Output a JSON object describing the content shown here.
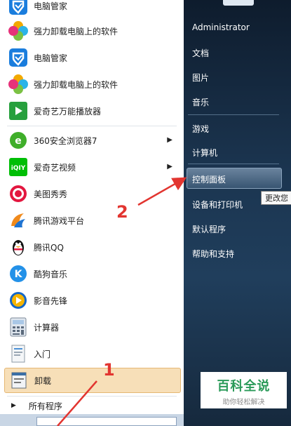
{
  "start_menu": {
    "programs": [
      {
        "label": "电脑管家",
        "icon": "tencent-pc-manager-icon"
      },
      {
        "label": "强力卸载电脑上的软件",
        "icon": "pinwheel-uninstall-icon"
      },
      {
        "label": "电脑管家",
        "icon": "tencent-pc-manager-icon"
      },
      {
        "label": "强力卸载电脑上的软件",
        "icon": "pinwheel-uninstall-icon"
      },
      {
        "label": "爱奇艺万能播放器",
        "icon": "iqiyi-player-icon"
      },
      {
        "label": "360安全浏览器7",
        "icon": "360-browser-icon"
      },
      {
        "label": "爱奇艺视频",
        "icon": "iqiyi-video-icon"
      },
      {
        "label": "美图秀秀",
        "icon": "meitu-icon"
      },
      {
        "label": "腾讯游戏平台",
        "icon": "tencent-games-icon"
      },
      {
        "label": "腾讯QQ",
        "icon": "qq-penguin-icon"
      },
      {
        "label": "酷狗音乐",
        "icon": "kugou-icon"
      },
      {
        "label": "影音先锋",
        "icon": "xfplay-icon"
      },
      {
        "label": "计算器",
        "icon": "calculator-icon"
      },
      {
        "label": "入门",
        "icon": "getting-started-icon"
      },
      {
        "label": "卸载",
        "icon": "uninstall-program-icon"
      }
    ],
    "all_programs": "所有程序"
  },
  "right_panel": {
    "user_name": "Administrator",
    "links": [
      "文档",
      "图片",
      "音乐",
      "游戏",
      "计算机",
      "控制面板",
      "设备和打印机",
      "默认程序",
      "帮助和支持"
    ],
    "tooltip": "更改您"
  },
  "annotations": {
    "step1": "1",
    "step2": "2",
    "color": "#e23530"
  },
  "watermark": {
    "title": "百科全说",
    "subtitle": "助你轻松解决"
  },
  "colors": {
    "selected_bg": "#f7dfb8",
    "right_bg": "#1b3550",
    "watermark_green": "#2a9a59"
  }
}
